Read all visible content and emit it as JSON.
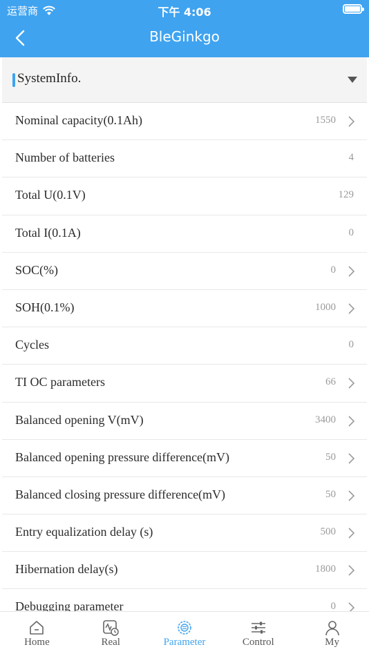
{
  "status": {
    "carrier": "运营商",
    "time": "下午 4:06"
  },
  "nav": {
    "title": "BleGinkgo"
  },
  "section": {
    "title": "SystemInfo."
  },
  "rows": [
    {
      "name": "Nominal capacity(0.1Ah)",
      "value": "1550",
      "editable": true
    },
    {
      "name": "Number of batteries",
      "value": "4",
      "editable": false
    },
    {
      "name": "Total U(0.1V)",
      "value": "129",
      "editable": false
    },
    {
      "name": "Total I(0.1A)",
      "value": "0",
      "editable": false
    },
    {
      "name": "SOC(%)",
      "value": "0",
      "editable": true
    },
    {
      "name": "SOH(0.1%)",
      "value": "1000",
      "editable": true
    },
    {
      "name": "Cycles",
      "value": "0",
      "editable": false
    },
    {
      "name": "TI OC parameters",
      "value": "66",
      "editable": true
    },
    {
      "name": "Balanced opening V(mV)",
      "value": "3400",
      "editable": true
    },
    {
      "name": "Balanced opening pressure difference(mV)",
      "value": "50",
      "editable": true
    },
    {
      "name": "Balanced closing pressure difference(mV)",
      "value": "50",
      "editable": true
    },
    {
      "name": "Entry equalization delay (s)",
      "value": "500",
      "editable": true
    },
    {
      "name": "Hibernation delay(s)",
      "value": "1800",
      "editable": true
    },
    {
      "name": "Debugging parameter",
      "value": "0",
      "editable": true
    }
  ],
  "tabs": [
    {
      "label": "Home",
      "icon": "home-icon",
      "active": false
    },
    {
      "label": "Real",
      "icon": "realtime-icon",
      "active": false
    },
    {
      "label": "Parameter",
      "icon": "parameter-icon",
      "active": true
    },
    {
      "label": "Control",
      "icon": "sliders-icon",
      "active": false
    },
    {
      "label": "My",
      "icon": "user-icon",
      "active": false
    }
  ],
  "colors": {
    "accent": "#3fa3f0",
    "header_bg": "#f4f4f4",
    "value_text": "#9a9a9a"
  }
}
